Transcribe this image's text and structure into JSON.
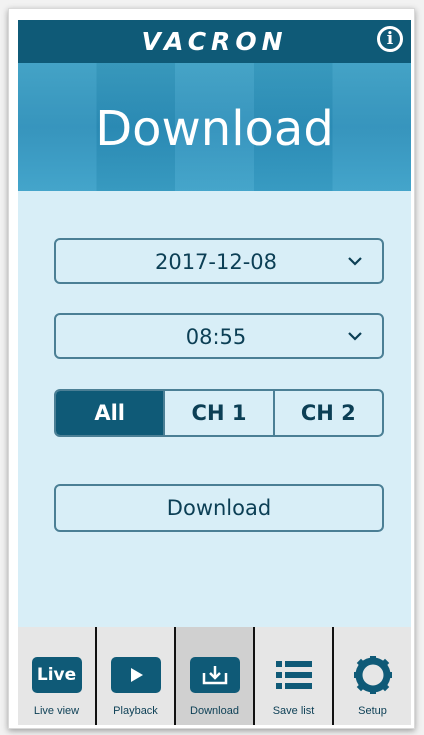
{
  "app": {
    "logo_text": "VACRON",
    "info_icon": "info-icon"
  },
  "hero": {
    "title": "Download"
  },
  "form": {
    "date_value": "2017-12-08",
    "time_value": "08:55",
    "channels": [
      {
        "label": "All",
        "selected": true
      },
      {
        "label": "CH 1",
        "selected": false
      },
      {
        "label": "CH 2",
        "selected": false
      }
    ],
    "download_label": "Download"
  },
  "tabbar": {
    "items": [
      {
        "label": "Live view",
        "icon": "live-icon",
        "icon_text": "Live"
      },
      {
        "label": "Playback",
        "icon": "play-icon"
      },
      {
        "label": "Download",
        "icon": "download-icon",
        "active": true
      },
      {
        "label": "Save list",
        "icon": "list-icon"
      },
      {
        "label": "Setup",
        "icon": "gear-icon"
      }
    ]
  },
  "colors": {
    "primary": "#0f5a77",
    "background": "#d8eef7",
    "hero": "#2c8fba",
    "border": "#4b7f95"
  }
}
